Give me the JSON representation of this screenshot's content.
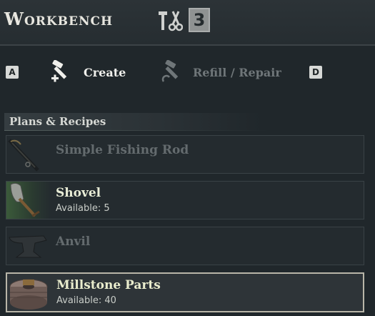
{
  "header": {
    "title": "Workbench",
    "tier": "3"
  },
  "tabs": {
    "left_key": "A",
    "right_key": "D",
    "create_label": "Create",
    "refill_label": "Refill / Repair"
  },
  "section": {
    "title": "Plans & Recipes"
  },
  "recipes": [
    {
      "name": "Simple Fishing Rod",
      "available": "",
      "state": "locked"
    },
    {
      "name": "Shovel",
      "available": "Available: 5",
      "state": "available"
    },
    {
      "name": "Anvil",
      "available": "",
      "state": "locked"
    },
    {
      "name": "Millstone Parts",
      "available": "Available: 40",
      "state": "selected"
    }
  ],
  "colors": {
    "background": "#20272b",
    "active_text": "#f0f0ec",
    "inactive_text": "#6f7679",
    "available_green": "#e8ecd6",
    "selected_border": "#b8b5a8"
  }
}
